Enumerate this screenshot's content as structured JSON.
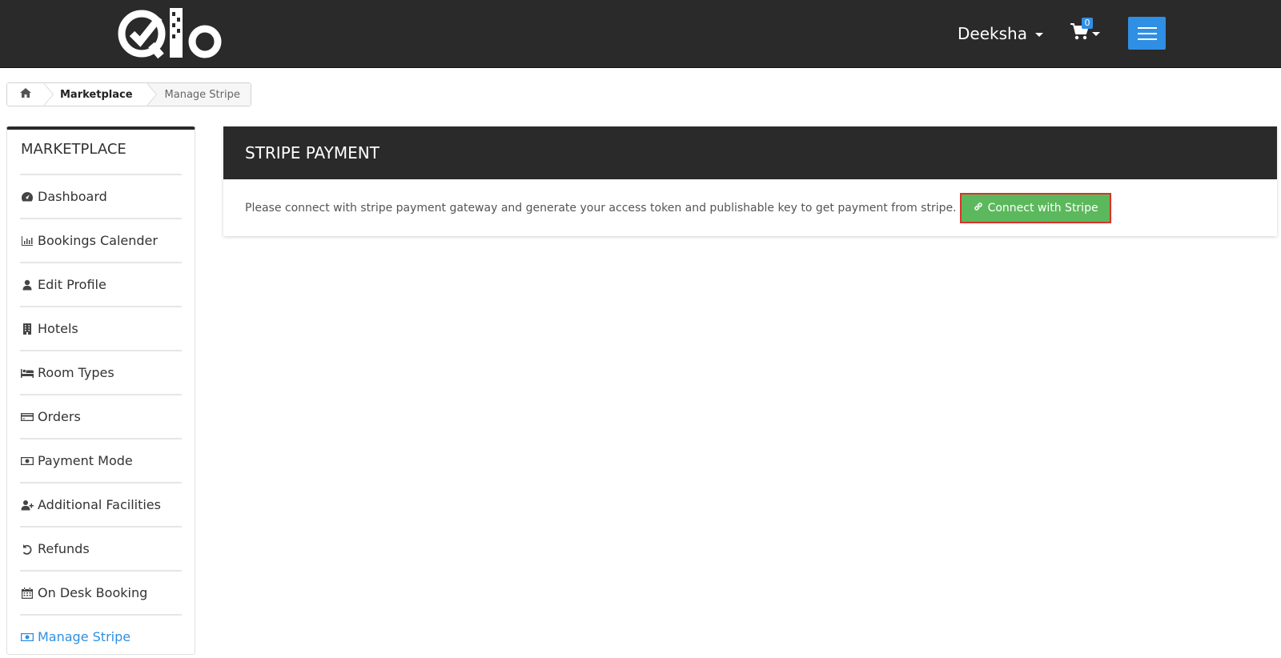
{
  "header": {
    "logo_text": "Qlo",
    "user_name": "Deeksha",
    "cart_count": "0"
  },
  "breadcrumb": {
    "items": [
      "Marketplace",
      "Manage Stripe"
    ]
  },
  "sidebar": {
    "title": "MARKETPLACE",
    "items": [
      {
        "label": "Dashboard",
        "icon": "dashboard-icon"
      },
      {
        "label": "Bookings Calender",
        "icon": "bar-chart-icon"
      },
      {
        "label": "Edit Profile",
        "icon": "user-icon"
      },
      {
        "label": "Hotels",
        "icon": "building-icon"
      },
      {
        "label": "Room Types",
        "icon": "bed-icon"
      },
      {
        "label": "Orders",
        "icon": "credit-card-icon"
      },
      {
        "label": "Payment Mode",
        "icon": "money-icon"
      },
      {
        "label": "Additional Facilities",
        "icon": "user-plus-icon"
      },
      {
        "label": "Refunds",
        "icon": "undo-icon"
      },
      {
        "label": "On Desk Booking",
        "icon": "calendar-icon"
      },
      {
        "label": "Manage Stripe",
        "icon": "money-icon",
        "active": true
      }
    ]
  },
  "panel": {
    "title": "STRIPE PAYMENT",
    "message": "Please connect with stripe payment gateway and generate your access token and publishable key to get payment from stripe.",
    "button_label": "Connect with Stripe"
  },
  "colors": {
    "header_bg": "#2a2a2a",
    "accent": "#2f8fe4",
    "button_green": "#5cb85c",
    "button_border": "#d9342b"
  }
}
